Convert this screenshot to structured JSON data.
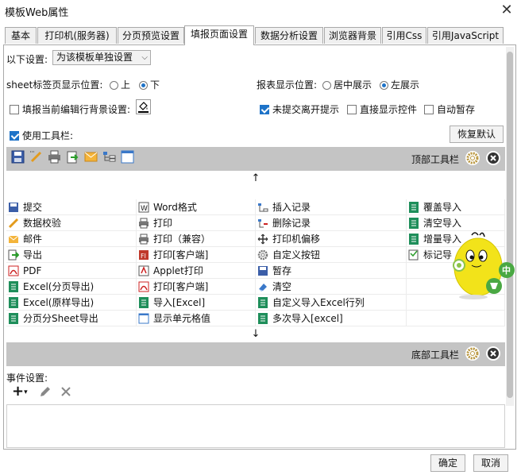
{
  "window": {
    "title": "模板Web属性",
    "close_label": "✕"
  },
  "tabs": [
    {
      "label": "基本",
      "active": false
    },
    {
      "label": "打印机(服务器)",
      "active": false
    },
    {
      "label": "分页预览设置",
      "active": false
    },
    {
      "label": "填报页面设置",
      "active": true
    },
    {
      "label": "数据分析设置",
      "active": false
    },
    {
      "label": "浏览器背景",
      "active": false
    },
    {
      "label": "引用Css",
      "active": false
    },
    {
      "label": "引用JavaScript",
      "active": false
    }
  ],
  "settings": {
    "scope_label": "以下设置:",
    "scope_value": "为该模板单独设置",
    "sheet_pos_label": "sheet标签页显示位置:",
    "sheet_pos_options": [
      "上",
      "下"
    ],
    "sheet_pos_selected": "下",
    "report_pos_label": "报表显示位置:",
    "report_pos_options": [
      "居中展示",
      "左展示"
    ],
    "report_pos_selected": "左展示",
    "bg_label": "填报当前编辑行背景设置:",
    "bg_checked": false,
    "unsubmitted_label": "未提交离开提示",
    "unsubmitted_checked": true,
    "direct_show_label": "直接显示控件",
    "direct_show_checked": false,
    "autosave_label": "自动暂存",
    "autosave_checked": false,
    "use_toolbar_label": "使用工具栏:",
    "use_toolbar_checked": true,
    "restore_default_label": "恢复默认"
  },
  "top_toolbar": {
    "label": "顶部工具栏",
    "icons": [
      "save-icon",
      "edit-icon",
      "print-icon",
      "export-icon",
      "mail-icon",
      "tree-icon",
      "window-icon"
    ]
  },
  "arrows": {
    "up": "↑",
    "down": "↓"
  },
  "buttons_grid": [
    [
      {
        "label": "提交",
        "icon": "save-icon"
      },
      {
        "label": "Word格式",
        "icon": "word-icon"
      },
      {
        "label": "插入记录",
        "icon": "insert-row-icon"
      },
      {
        "label": "覆盖导入",
        "icon": "excel-icon"
      }
    ],
    [
      {
        "label": "数据校验",
        "icon": "edit-icon"
      },
      {
        "label": "打印",
        "icon": "print-icon"
      },
      {
        "label": "删除记录",
        "icon": "delete-row-icon"
      },
      {
        "label": "清空导入",
        "icon": "excel-icon"
      }
    ],
    [
      {
        "label": "邮件",
        "icon": "mail-icon"
      },
      {
        "label": "打印（兼容）",
        "icon": "print-icon"
      },
      {
        "label": "打印机偏移",
        "icon": "move-icon"
      },
      {
        "label": "增量导入",
        "icon": "excel-icon"
      }
    ],
    [
      {
        "label": "导出",
        "icon": "export-icon"
      },
      {
        "label": "打印[客户端]",
        "icon": "flash-print-icon"
      },
      {
        "label": "自定义按钮",
        "icon": "gear-icon"
      },
      {
        "label": "标记导",
        "icon": "mark-icon"
      }
    ],
    [
      {
        "label": "PDF",
        "icon": "pdf-icon"
      },
      {
        "label": "Applet打印",
        "icon": "applet-icon"
      },
      {
        "label": "暂存",
        "icon": "save-icon"
      },
      {
        "label": "",
        "icon": ""
      }
    ],
    [
      {
        "label": "Excel(分页导出)",
        "icon": "excel-icon"
      },
      {
        "label": "打印[客户端]",
        "icon": "pdf-icon"
      },
      {
        "label": "清空",
        "icon": "eraser-icon"
      },
      {
        "label": "",
        "icon": ""
      }
    ],
    [
      {
        "label": "Excel(原样导出)",
        "icon": "excel-icon"
      },
      {
        "label": "导入[Excel]",
        "icon": "excel-icon"
      },
      {
        "label": "自定义导入Excel行列",
        "icon": "excel-icon"
      },
      {
        "label": "",
        "icon": ""
      }
    ],
    [
      {
        "label": "分页分Sheet导出",
        "icon": "excel-icon"
      },
      {
        "label": "显示单元格值",
        "icon": "window-icon"
      },
      {
        "label": "多次导入[excel]",
        "icon": "excel-icon"
      },
      {
        "label": "",
        "icon": ""
      }
    ]
  ],
  "bottom_toolbar": {
    "label": "底部工具栏"
  },
  "events": {
    "label": "事件设置:",
    "add_label": "+"
  },
  "mascot": {
    "badge_top": "中"
  },
  "footer": {
    "ok_label": "确定",
    "cancel_label": "取消"
  },
  "colors": {
    "accent": "#1e73c8",
    "toolbar_gray": "#c4c4c4",
    "excel_green": "#1e8e5a"
  }
}
